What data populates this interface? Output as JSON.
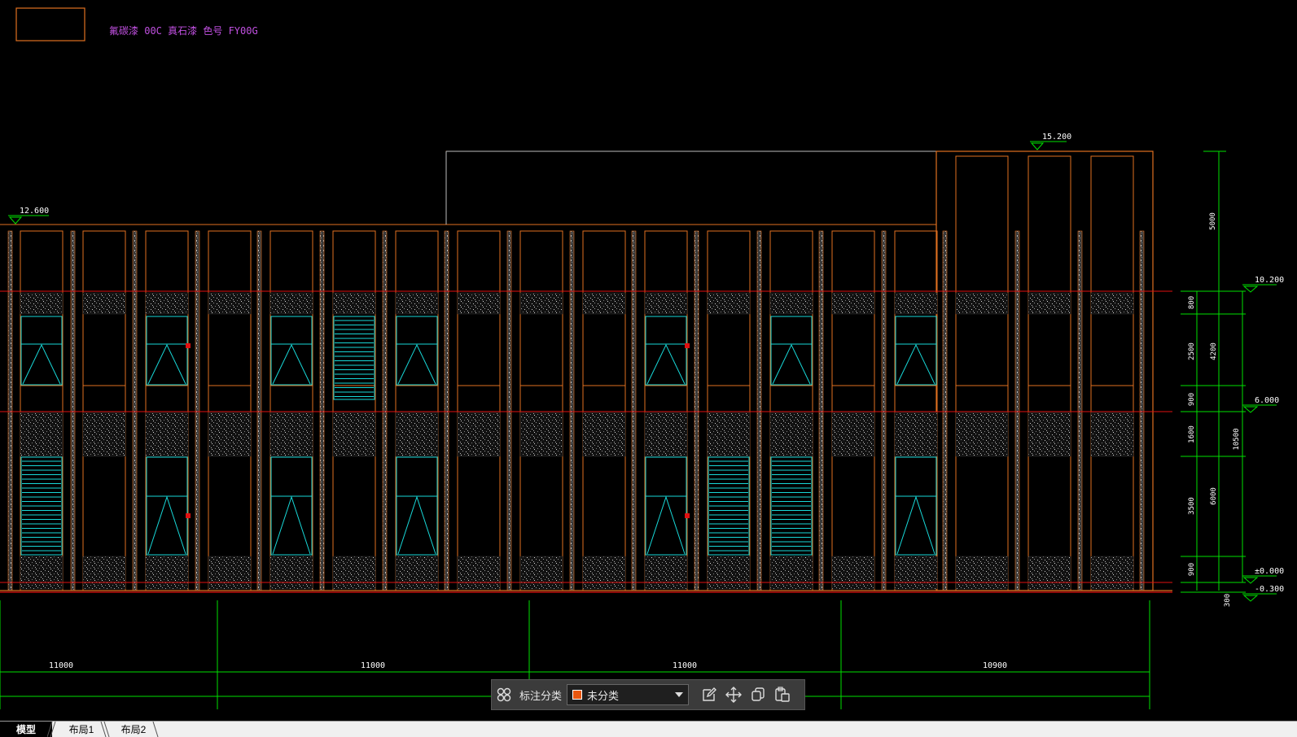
{
  "drawing": {
    "note_text": "氟碳漆 00C  真石漆  色号 FY00G",
    "elevations": {
      "roof_high": "15.200",
      "roof_low": "12.600",
      "level_10": "10.200",
      "level_6": "6.000",
      "ground": "±0.000",
      "base": "-0.300"
    },
    "right_dims": {
      "top": "5000",
      "d800": "800",
      "d2500": "2500",
      "d4200": "4200",
      "d900a": "900",
      "d1600": "1600",
      "d10500": "10500",
      "d3500": "3500",
      "d6000": "6000",
      "d900b": "900",
      "d300": "300"
    },
    "bottom_dims": [
      "11000",
      "11000",
      "11000",
      "10900"
    ],
    "colors": {
      "frame": "#e07020",
      "glass": "#18d8d8",
      "dim": "#00e000",
      "level_line": "#e01010",
      "note": "#c050e0",
      "text": "#ffffff"
    }
  },
  "toolbar": {
    "grid_icon": "grid-icon",
    "category_label": "标注分类",
    "selected_category": "未分类",
    "edit_icon": "edit-icon",
    "move_icon": "move-icon",
    "copy_icon": "copy-icon",
    "paste_icon": "paste-icon"
  },
  "tabs": [
    {
      "label": "模型",
      "active": true
    },
    {
      "label": "布局1",
      "active": false
    },
    {
      "label": "布局2",
      "active": false
    }
  ]
}
